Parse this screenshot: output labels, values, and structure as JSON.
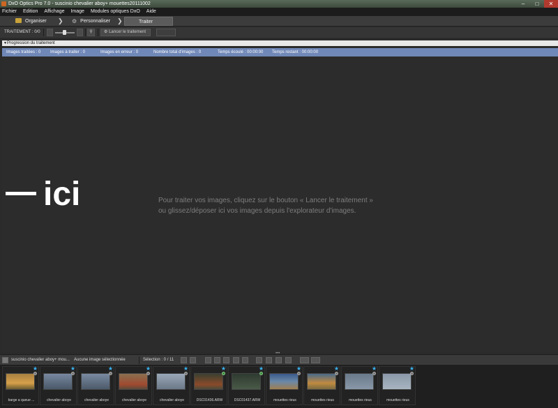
{
  "window": {
    "title": "DxO Optics Pro 7.0 - suscinio chevalier aboy+ mouettes20111002"
  },
  "menu": [
    "Fichier",
    "Edition",
    "Affichage",
    "Image",
    "Modules optiques DxO",
    "Aide"
  ],
  "modes": {
    "organiser": "Organiser",
    "personnaliser": "Personnaliser",
    "traiter": "Traiter"
  },
  "toolbar": {
    "label": "TRAITEMENT : 0/0",
    "launch_button": "Lancer le traitement"
  },
  "progress": {
    "header": "Progression du traitement",
    "stats": [
      "Images traitées : 0",
      "Images à traiter : 0",
      "Images en erreur : 0",
      "Nombre total d'images : 0",
      "Temps écoulé : 00:00:00",
      "Temps restant : 00:00:00"
    ]
  },
  "main": {
    "hint_line1": "Pour traiter vos images, cliquez sur le bouton « Lancer le traitement »",
    "hint_line2": "ou glissez/déposer ici vos images depuis l'explorateur d'images.",
    "annotation": "ici"
  },
  "filmstrip_bar": {
    "project": "suscinio chevalier aboy+ mou...",
    "selection_status": "Aucune image sélectionnée",
    "selection_count": "Sélection : 0 / 11"
  },
  "thumbnails": [
    {
      "label": "barge a queue ...",
      "dot": "gray",
      "tone": "#b07a2a"
    },
    {
      "label": "chevalier aboye",
      "dot": "gray",
      "tone": "#5a6878"
    },
    {
      "label": "chevalier aboye",
      "dot": "gray",
      "tone": "#5c6a7a"
    },
    {
      "label": "chevalier aboye",
      "dot": "gray",
      "tone": "#7a6a52"
    },
    {
      "label": "chevalier aboye",
      "dot": "gray",
      "tone": "#7a8898"
    },
    {
      "label": "DSC01436.ARW",
      "dot": "green",
      "tone": "#4a5038"
    },
    {
      "label": "DSC01437.ARW",
      "dot": "green",
      "tone": "#3e4a3a"
    },
    {
      "label": "mouettes rieus",
      "dot": "gray",
      "tone": "#5a7898"
    },
    {
      "label": "mouettes rieus",
      "dot": "gray",
      "tone": "#8a7040"
    },
    {
      "label": "mouettes rieus",
      "dot": "gray",
      "tone": "#6a7888"
    },
    {
      "label": "mouettes rieus",
      "dot": "gray",
      "tone": "#8898a8"
    }
  ],
  "colors": {
    "stats_bar": "#7088b8",
    "star": "#3ab4f2"
  }
}
